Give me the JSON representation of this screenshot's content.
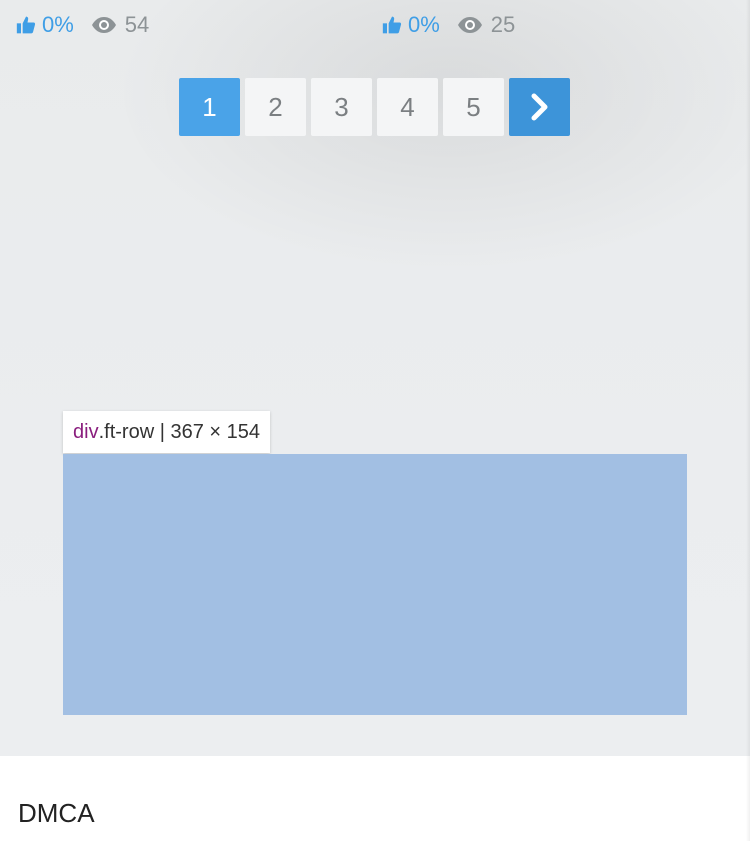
{
  "stats": [
    {
      "like_pct": "0%",
      "views": "54"
    },
    {
      "like_pct": "0%",
      "views": "25"
    }
  ],
  "pagination": {
    "pages": [
      "1",
      "2",
      "3",
      "4",
      "5"
    ],
    "active_page": "1",
    "next_icon": "chevron-right-icon"
  },
  "inspector": {
    "tag": "div",
    "selector": ".ft-row",
    "separator": " | ",
    "dimensions": "367 × 154"
  },
  "footer": {
    "dmca_label": "DMCA"
  },
  "colors": {
    "accent_blue": "#4aa3e8",
    "next_blue": "#3d94d9",
    "highlight": "#a2bfe3",
    "tag_purple": "#8a1e7e",
    "muted_gray": "#8d9396"
  }
}
